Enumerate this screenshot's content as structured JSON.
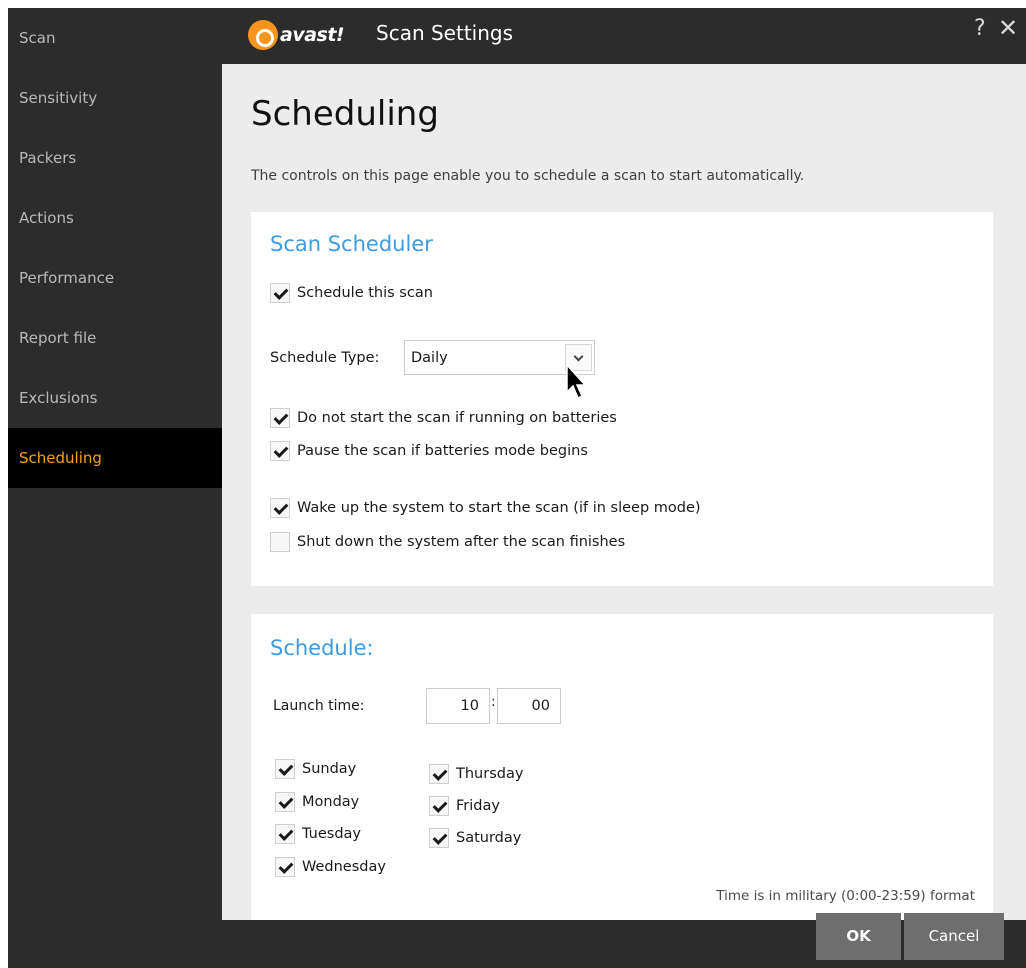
{
  "sidebar": {
    "items": [
      {
        "label": "Scan"
      },
      {
        "label": "Sensitivity"
      },
      {
        "label": "Packers"
      },
      {
        "label": "Actions"
      },
      {
        "label": "Performance"
      },
      {
        "label": "Report file"
      },
      {
        "label": "Exclusions"
      },
      {
        "label": "Scheduling"
      }
    ],
    "active_index": 7
  },
  "titlebar": {
    "logo_text": "avast!",
    "title": "Scan Settings",
    "help_label": "?",
    "close_label": "✕"
  },
  "page": {
    "title": "Scheduling",
    "description": "The controls on this page enable you to schedule a scan to start automatically."
  },
  "scheduler": {
    "title": "Scan Scheduler",
    "schedule_this_scan": {
      "label": "Schedule this scan",
      "checked": true
    },
    "schedule_type_label": "Schedule Type:",
    "schedule_type_value": "Daily",
    "options": [
      {
        "label": "Do not start the scan if running on batteries",
        "checked": true
      },
      {
        "label": "Pause the scan if batteries mode begins",
        "checked": true
      },
      {
        "label": "Wake up the system to start the scan (if in sleep mode)",
        "checked": true
      },
      {
        "label": "Shut down the system after the scan finishes",
        "checked": false
      }
    ]
  },
  "schedule": {
    "title": "Schedule:",
    "launch_time_label": "Launch time:",
    "hour": "10",
    "minute": "00",
    "time_separator": ":",
    "days_left": [
      {
        "label": "Sunday",
        "checked": true
      },
      {
        "label": "Monday",
        "checked": true
      },
      {
        "label": "Tuesday",
        "checked": true
      },
      {
        "label": "Wednesday",
        "checked": true
      }
    ],
    "days_right": [
      {
        "label": "Thursday",
        "checked": true
      },
      {
        "label": "Friday",
        "checked": true
      },
      {
        "label": "Saturday",
        "checked": true
      }
    ],
    "note": "Time is in military (0:00-23:59) format"
  },
  "footer": {
    "ok_label": "OK",
    "cancel_label": "Cancel"
  },
  "colors": {
    "accent": "#f7a21b",
    "heading_blue": "#3d9be0",
    "sidebar_bg": "#2c2c2c",
    "content_bg": "#ececec"
  }
}
